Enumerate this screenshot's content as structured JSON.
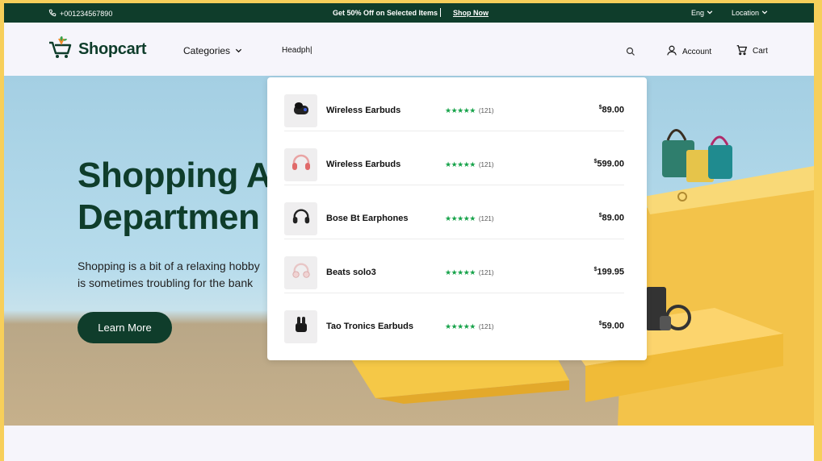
{
  "topbar": {
    "phone": "+001234567890",
    "promo": "Get 50% Off on Selected Items",
    "shop_now": "Shop Now",
    "language": "Eng",
    "location": "Location"
  },
  "header": {
    "logo": "Shopcart",
    "categories": "Categories",
    "search_value": "Headph|",
    "account": "Account",
    "cart": "Cart"
  },
  "hero": {
    "title_line1": "Shopping A",
    "title_line2": "Departmen",
    "sub_line1": "Shopping is a bit of a relaxing hobby",
    "sub_line2": "is sometimes troubling for the bank",
    "button": "Learn More"
  },
  "dropdown": {
    "results": [
      {
        "name": "Wireless Earbuds",
        "stars": "★★★★★",
        "reviews": "(121)",
        "currency": "$",
        "price": "89.00",
        "icon": "earbuds-icon"
      },
      {
        "name": "Wireless Earbuds",
        "stars": "★★★★★",
        "reviews": "(121)",
        "currency": "$",
        "price": "599.00",
        "icon": "headphones-icon"
      },
      {
        "name": "Bose Bt Earphones",
        "stars": "★★★★★",
        "reviews": "(121)",
        "currency": "$",
        "price": "89.00",
        "icon": "headphones-icon"
      },
      {
        "name": "Beats solo3",
        "stars": "★★★★★",
        "reviews": "(121)",
        "currency": "$",
        "price": "199.95",
        "icon": "headphones-icon"
      },
      {
        "name": "Tao Tronics Earbuds",
        "stars": "★★★★★",
        "reviews": "(121)",
        "currency": "$",
        "price": "59.00",
        "icon": "earbuds-icon"
      }
    ]
  },
  "colors": {
    "brand": "#0f3d2b",
    "star": "#17a34a",
    "frame": "#f7cf5a"
  }
}
